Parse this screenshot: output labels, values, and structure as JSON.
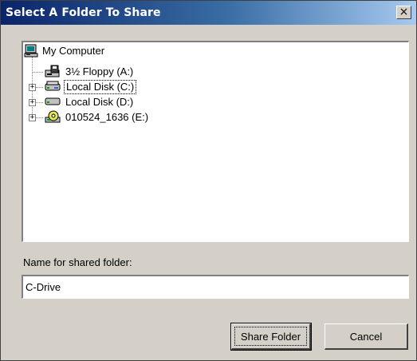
{
  "dialog": {
    "title": "Select A Folder To Share",
    "close_label": "×"
  },
  "tree": {
    "root": {
      "label": "My Computer",
      "icon": "computer-icon"
    },
    "items": [
      {
        "label": "3½ Floppy (A:)",
        "icon": "floppy-drive-icon",
        "expandable": false,
        "selected": false
      },
      {
        "label": "Local Disk (C:)",
        "icon": "hard-disk-icon",
        "expandable": true,
        "selected": true
      },
      {
        "label": "Local Disk (D:)",
        "icon": "hard-disk-icon",
        "expandable": true,
        "selected": false
      },
      {
        "label": "010524_1636 (E:)",
        "icon": "cd-drive-icon",
        "expandable": true,
        "selected": false
      }
    ]
  },
  "form": {
    "name_label": "Name for shared folder:",
    "name_value": "C-Drive"
  },
  "buttons": {
    "share_label": "Share Folder",
    "cancel_label": "Cancel"
  }
}
